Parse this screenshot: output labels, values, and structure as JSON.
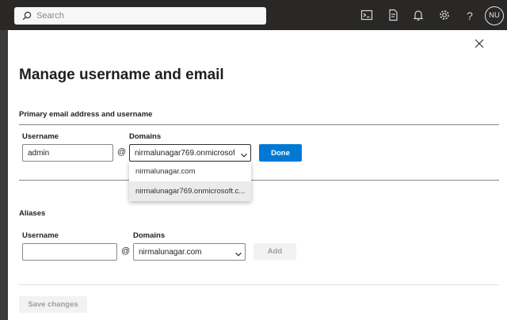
{
  "topbar": {
    "search_placeholder": "Search",
    "icons": [
      "cloud-shell-icon",
      "feedback-icon",
      "notifications-icon",
      "settings-icon",
      "help-icon"
    ],
    "help_glyph": "?",
    "avatar_initials": "NU"
  },
  "panel": {
    "title": "Manage username and email",
    "primary": {
      "section_title": "Primary email address and username",
      "username_label": "Username",
      "username_value": "admin",
      "at_symbol": "@",
      "domains_label": "Domains",
      "domain_selected": "nirmalunagar769.onmicrosof...",
      "done_label": "Done",
      "dropdown_options": [
        {
          "label": "nirmalunagar.com",
          "selected": false
        },
        {
          "label": "nirmalunagar769.onmicrosoft.c...",
          "selected": true
        }
      ]
    },
    "aliases": {
      "section_title": "Aliases",
      "username_label": "Username",
      "username_value": "",
      "at_symbol": "@",
      "domains_label": "Domains",
      "domain_selected": "nirmalunagar.com",
      "add_label": "Add"
    },
    "save_label": "Save changes"
  },
  "colors": {
    "accent": "#0078d4",
    "topbar_bg": "#292827",
    "disabled_bg": "#f3f2f1"
  }
}
